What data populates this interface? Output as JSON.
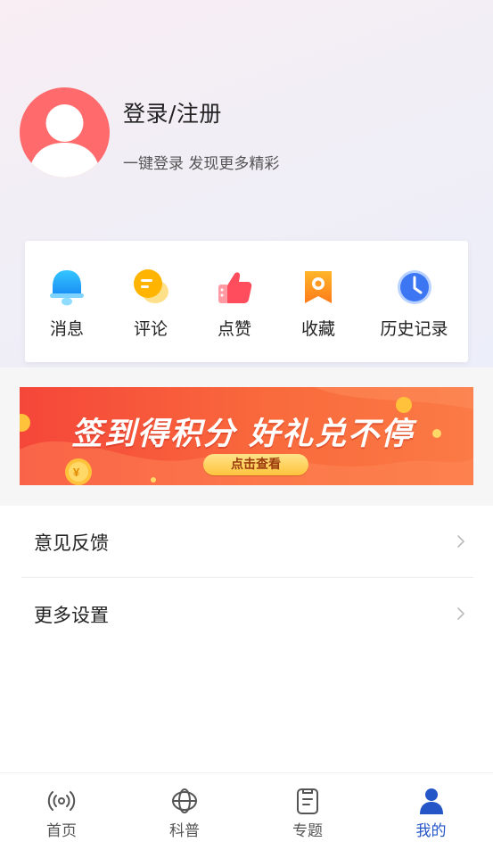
{
  "profile": {
    "title": "登录/注册",
    "subtitle": "一键登录 发现更多精彩"
  },
  "actions": [
    {
      "label": "消息",
      "icon": "bell-icon"
    },
    {
      "label": "评论",
      "icon": "comment-icon"
    },
    {
      "label": "点赞",
      "icon": "thumbs-up-icon"
    },
    {
      "label": "收藏",
      "icon": "bookmark-icon"
    },
    {
      "label": "历史记录",
      "icon": "clock-icon"
    }
  ],
  "banner": {
    "title": "签到得积分 好礼兑不停",
    "cta": "点击查看"
  },
  "list": [
    {
      "label": "意见反馈"
    },
    {
      "label": "更多设置"
    }
  ],
  "tabs": [
    {
      "label": "首页",
      "icon": "broadcast-icon",
      "active": false
    },
    {
      "label": "科普",
      "icon": "globe-icon",
      "active": false
    },
    {
      "label": "专题",
      "icon": "document-icon",
      "active": false
    },
    {
      "label": "我的",
      "icon": "user-icon",
      "active": true
    }
  ],
  "colors": {
    "accent": "#2456c8",
    "avatar": "#ff6b6c",
    "banner": "#f5463a"
  }
}
